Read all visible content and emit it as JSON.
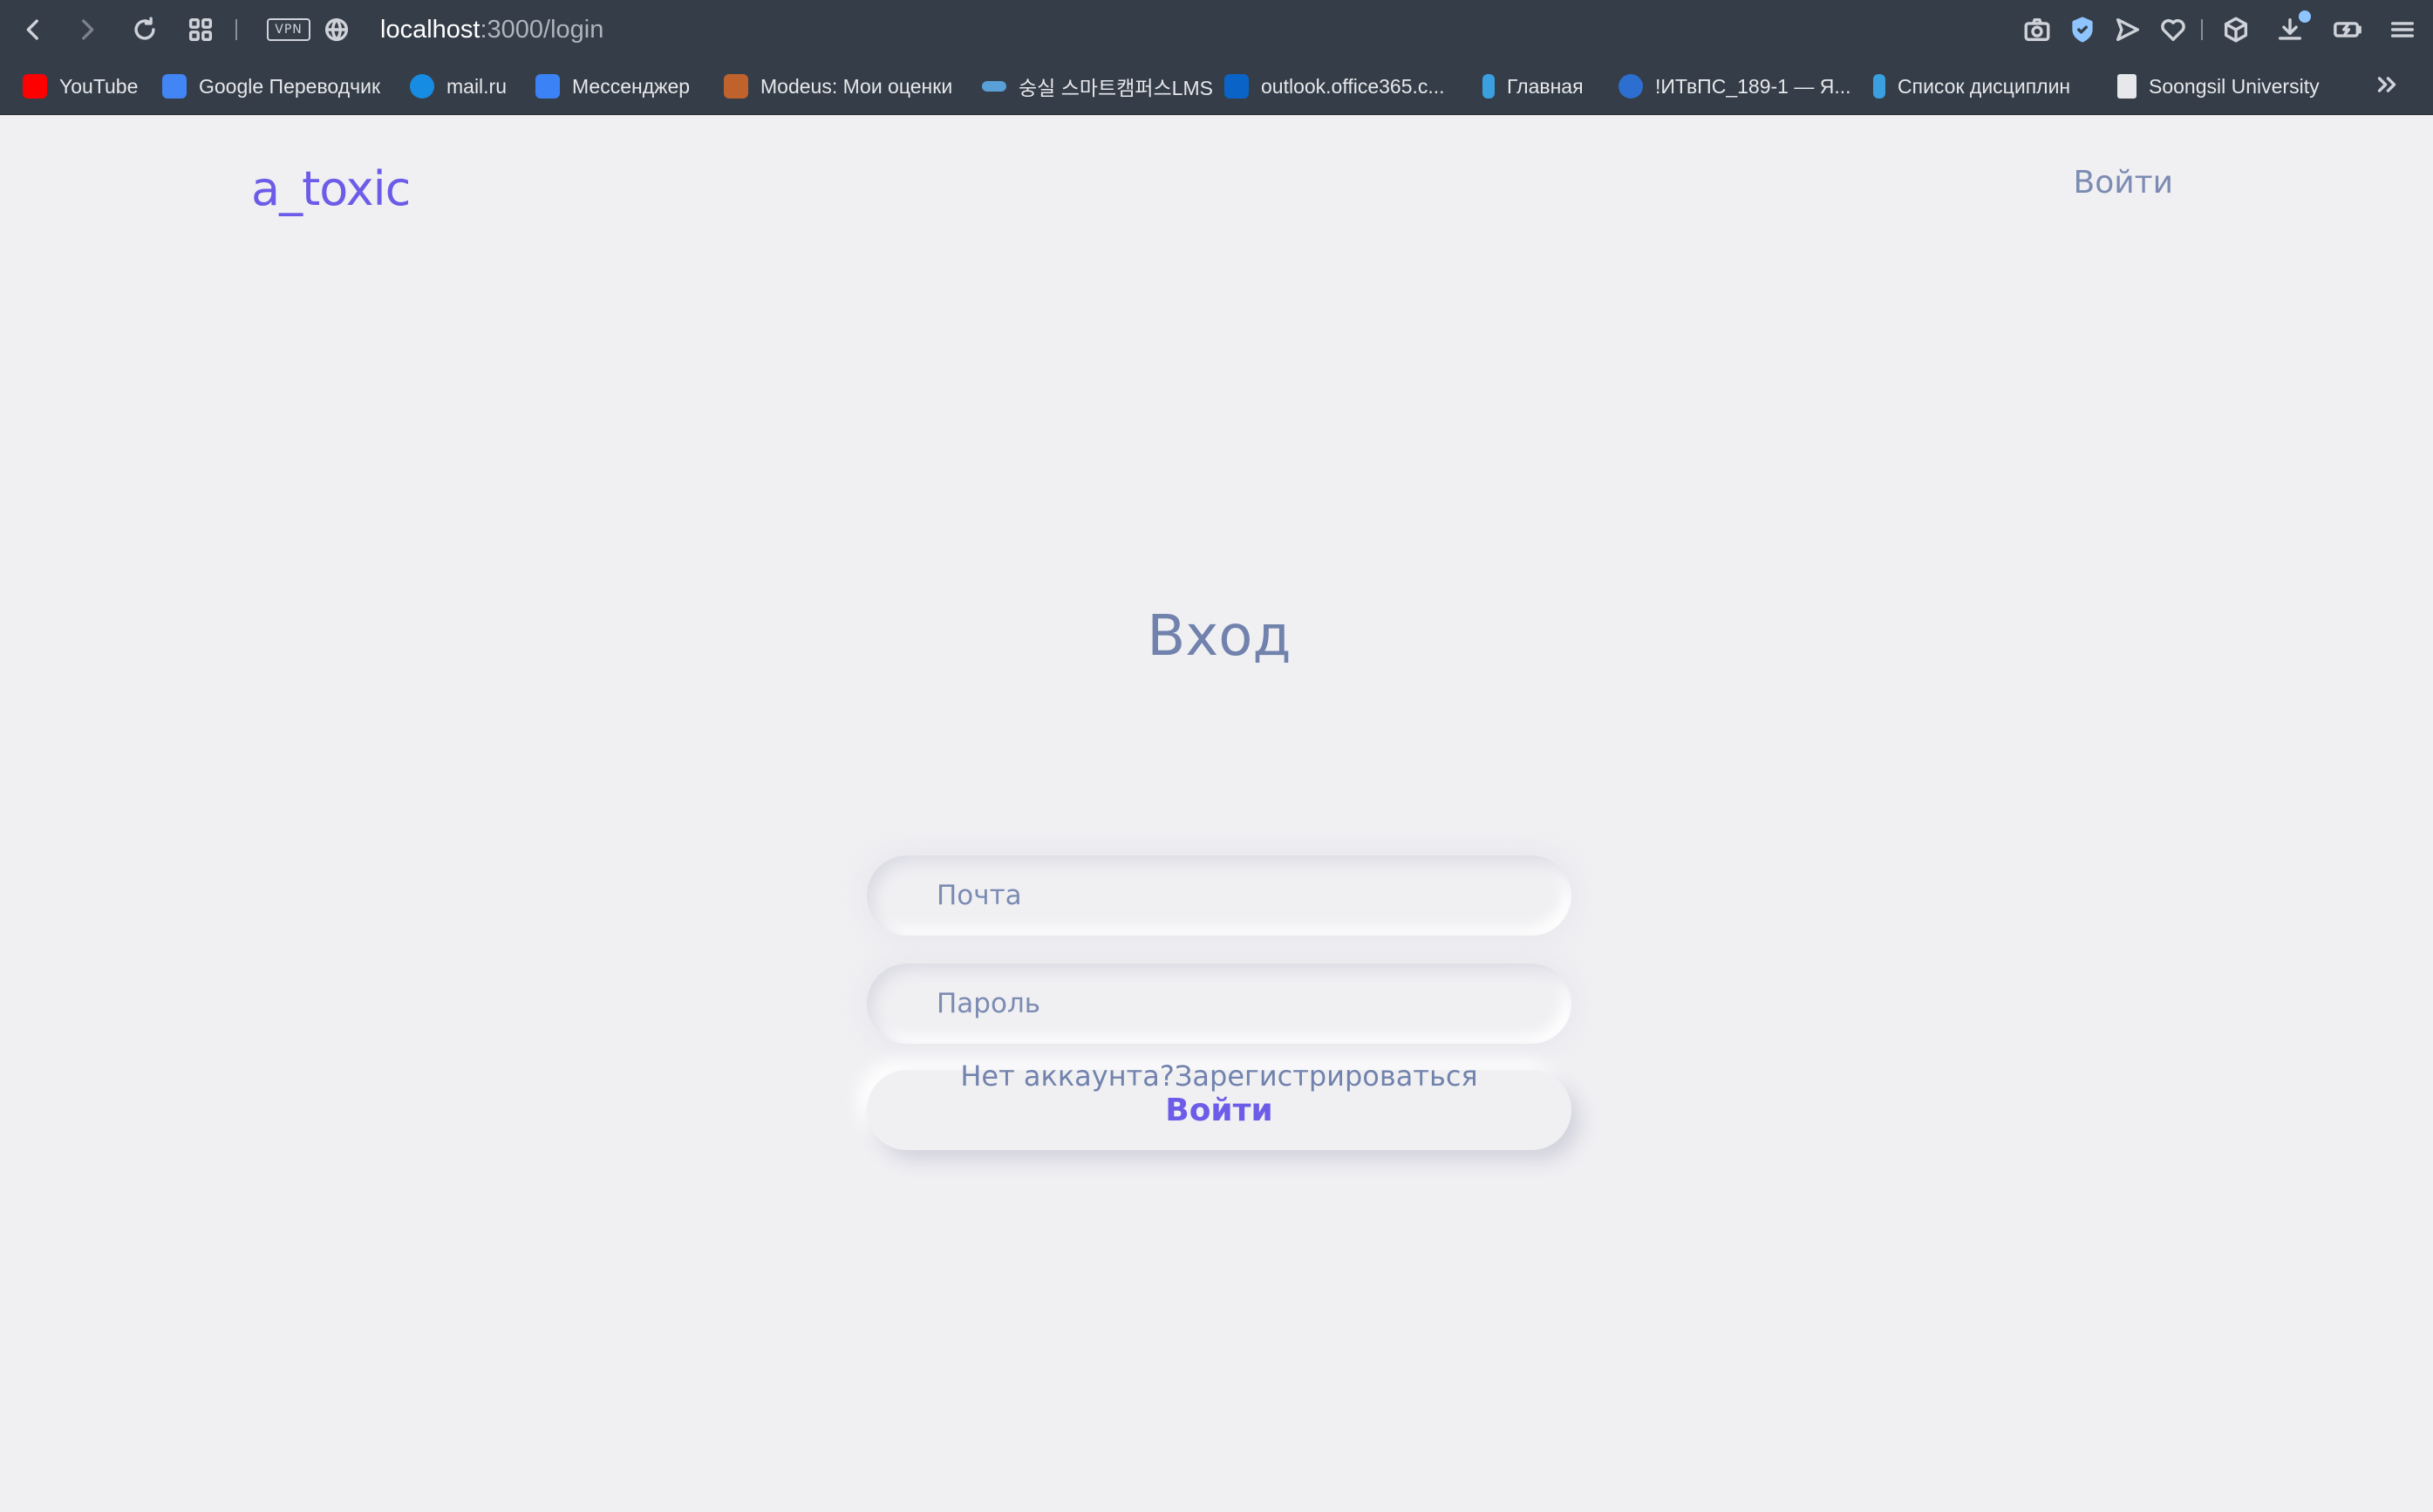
{
  "browser": {
    "url_host": "localhost",
    "url_rest": ":3000/login",
    "vpn_label": "VPN",
    "toolbar_icons": [
      "back-icon",
      "forward-icon",
      "reload-icon",
      "tab-grid-icon",
      "globe-icon",
      "camera-icon",
      "shield-check-icon",
      "send-icon",
      "heart-icon",
      "cube-icon",
      "download-icon",
      "battery-icon",
      "menu-icon"
    ],
    "bookmarks": [
      {
        "label": "YouTube",
        "color": "#ff0000"
      },
      {
        "label": "Google Переводчик",
        "color": "#4285f4"
      },
      {
        "label": "mail.ru",
        "color": "#168de2"
      },
      {
        "label": "Мессенджер",
        "color": "#3b82f6"
      },
      {
        "label": "Modeus: Мои оценки",
        "color": "#c0622b"
      },
      {
        "label": "숭실 스마트캠퍼스LMS",
        "color": "#5aa0d8"
      },
      {
        "label": "outlook.office365.c...",
        "color": "#0a64c8"
      },
      {
        "label": "Главная",
        "color": "#3aa0e0"
      },
      {
        "label": "!ИТвПС_189-1 — Я...",
        "color": "#2d6fd0"
      },
      {
        "label": "Список дисциплин",
        "color": "#3aa0e0"
      },
      {
        "label": "Soongsil University",
        "color": "#e6e8eb"
      }
    ]
  },
  "header": {
    "logo": "a_toxic",
    "login_link": "Войти"
  },
  "login_form": {
    "title": "Вход",
    "email_placeholder": "Почта",
    "password_placeholder": "Пароль",
    "submit_label": "Войти",
    "no_account_text": "Нет аккаунта?",
    "register_link": "Зарегистрироваться"
  },
  "colors": {
    "accent": "#6c5ce7",
    "muted_text": "#7182ad",
    "background": "#f0f0f3",
    "chrome": "#353d48"
  }
}
